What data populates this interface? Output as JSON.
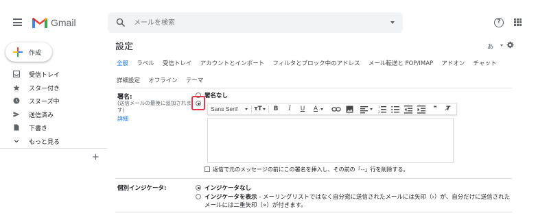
{
  "header": {
    "app_name": "Gmail",
    "search_placeholder": "メールを検索",
    "help_symbol": "?"
  },
  "sidebar": {
    "compose_label": "作成",
    "items": [
      {
        "label": "受信トレイ",
        "icon": "inbox-icon"
      },
      {
        "label": "スター付き",
        "icon": "star-icon"
      },
      {
        "label": "スヌーズ中",
        "icon": "clock-icon"
      },
      {
        "label": "送信済み",
        "icon": "send-icon"
      },
      {
        "label": "下書き",
        "icon": "file-icon"
      },
      {
        "label": "もっと見る",
        "icon": "chevron-down-icon"
      }
    ],
    "labels_add": "+"
  },
  "settings": {
    "title": "設定",
    "lang_button": "あ",
    "tabs": [
      "全般",
      "ラベル",
      "受信トレイ",
      "アカウントとインポート",
      "フィルタとブロック中のアドレス",
      "メール転送と POP/IMAP",
      "アドオン",
      "チャット"
    ],
    "tabs_row2": [
      "詳細設定",
      "オフライン",
      "テーマ"
    ],
    "active_tab": "全般",
    "signature": {
      "label": "署名:",
      "description": "(送信メールの最後に追加されます)",
      "detail_link": "詳細",
      "option_none": "署名なし",
      "selected": "custom",
      "toolbar": {
        "font": "Sans Serif",
        "size_icon": "тT",
        "bold": "B",
        "italic": "I",
        "underline": "U",
        "text_color": "A",
        "quote": "❞",
        "clear_format": "T̸"
      },
      "checkbox_label": "返信で元のメッセージの前にこの署名を挿入し、その前の「--」行を削除する。"
    },
    "indicator": {
      "label": "個別インジケータ:",
      "option_none": "インジケータなし",
      "option_show_bold": "インジケータを表示",
      "option_show_desc_line1": " - メーリングリストではなく自分宛に送信されたメールには矢印（›）が、自分だけに送信された",
      "option_show_desc_line2": "メールには二重矢印（»）が付きます。",
      "selected": "none"
    }
  },
  "colors": {
    "accent": "#1a73e8",
    "highlight": "#e8334a",
    "gmail_red": "#ea4335"
  }
}
